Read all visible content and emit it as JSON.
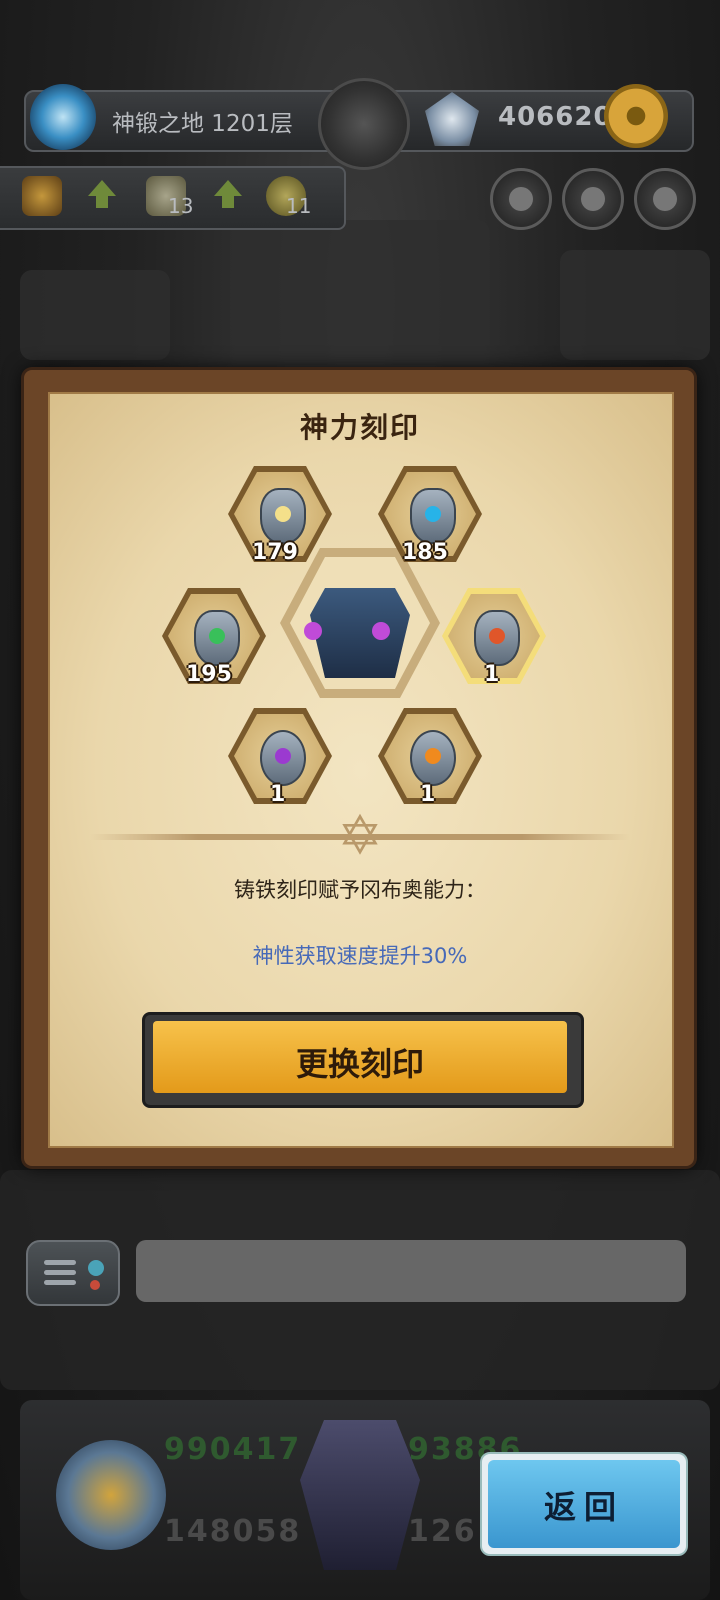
{
  "header": {
    "floor_label": "神锻之地 1201层",
    "currency_value": "406620"
  },
  "stats": {
    "item1_count": "13",
    "item2_count": "11"
  },
  "panel": {
    "title": "神力刻印",
    "slots": [
      {
        "name": "sun-rune",
        "count": "179",
        "color": "#f4e08a"
      },
      {
        "name": "moon-rune",
        "count": "185",
        "color": "#27b3e8"
      },
      {
        "name": "leaf-rune",
        "count": "195",
        "color": "#39c05a"
      },
      {
        "name": "fire-rune",
        "count": "1",
        "color": "#e0562a"
      },
      {
        "name": "purple-flame-rune",
        "count": "1",
        "color": "#9b3ad0"
      },
      {
        "name": "orange-swirl-rune",
        "count": "1",
        "color": "#f08a1e"
      }
    ],
    "description_title": "铸铁刻印赋予冈布奥能力：",
    "description_effect": "神性获取速度提升30%",
    "change_button_label": "更换刻印"
  },
  "bottom": {
    "stat_left_top": "990417",
    "stat_left_bottom": "148058",
    "stat_right_top": "93886",
    "stat_right_bottom": "126",
    "back_button_label": "返回"
  }
}
